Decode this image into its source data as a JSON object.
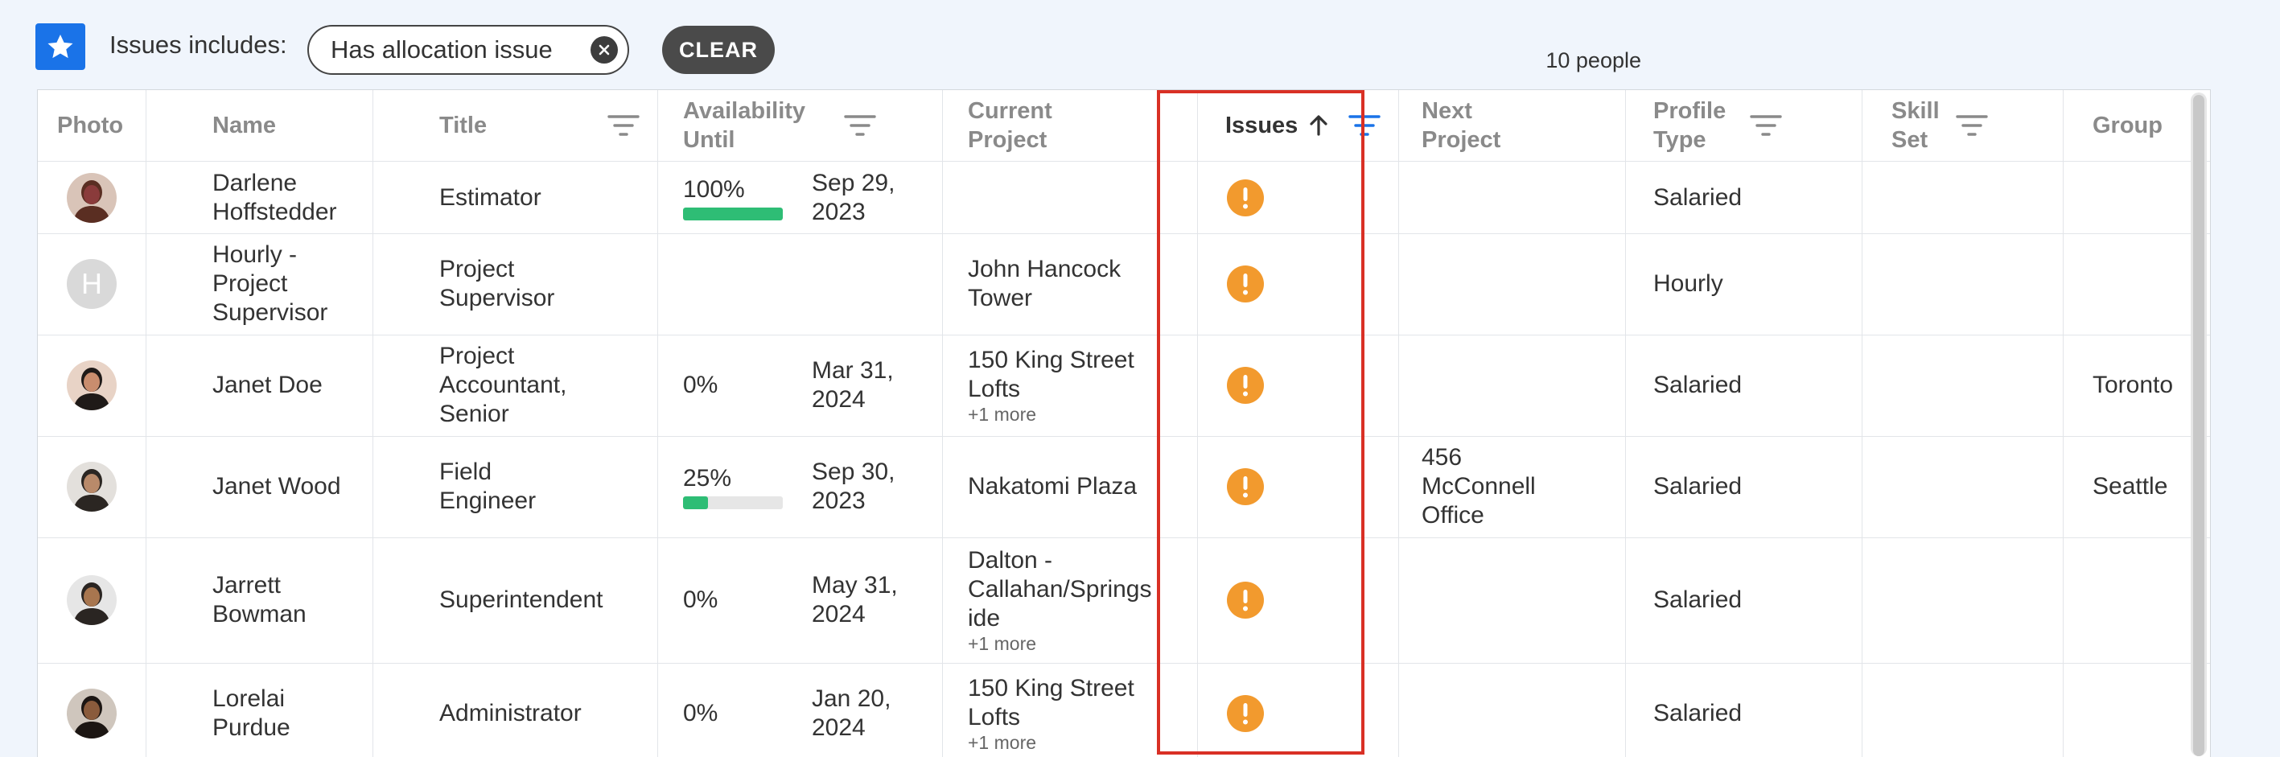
{
  "toolbar": {
    "filter_label": "Issues includes:",
    "chip_label": "Has allocation issue",
    "clear_label": "CLEAR",
    "people_count": "10 people"
  },
  "columns": {
    "photo": "Photo",
    "name": "Name",
    "title": "Title",
    "availability": "Availability Until",
    "current_project": "Current Project",
    "issues": "Issues",
    "next_project": "Next Project",
    "profile_type": "Profile Type",
    "skill_set": "Skill Set",
    "group": "Group"
  },
  "colors": {
    "accent": "#1a73e8",
    "issue": "#f29a2e",
    "highlight": "#d93025",
    "progress": "#2ebd75"
  },
  "rows": [
    {
      "name": "Darlene Hoffstedder",
      "title": "Estimator",
      "availability_pct": "100%",
      "availability_fill": 1.0,
      "availability_date": "Sep 29, 2023",
      "current_project": "",
      "current_more": "",
      "next_project": "",
      "profile_type": "Salaried",
      "skill_set": "",
      "group": "",
      "avatar": "photo"
    },
    {
      "name": "Hourly - Project Supervisor",
      "title": "Project Supervisor",
      "availability_pct": "",
      "availability_fill": null,
      "availability_date": "",
      "current_project": "John Hancock Tower",
      "current_more": "",
      "next_project": "",
      "profile_type": "Hourly",
      "skill_set": "",
      "group": "",
      "avatar": "initial",
      "avatar_initial": "H"
    },
    {
      "name": "Janet Doe",
      "title": "Project Accountant, Senior",
      "availability_pct": "0%",
      "availability_fill": null,
      "availability_date": "Mar 31, 2024",
      "current_project": "150 King Street Lofts",
      "current_more": "+1 more",
      "next_project": "",
      "profile_type": "Salaried",
      "skill_set": "",
      "group": "Toronto",
      "avatar": "photo"
    },
    {
      "name": "Janet Wood",
      "title": "Field Engineer",
      "availability_pct": "25%",
      "availability_fill": 0.25,
      "availability_date": "Sep 30, 2023",
      "current_project": "Nakatomi Plaza",
      "current_more": "",
      "next_project": "456 McConnell Office",
      "profile_type": "Salaried",
      "skill_set": "",
      "group": "Seattle",
      "avatar": "photo"
    },
    {
      "name": "Jarrett Bowman",
      "title": "Superintendent",
      "availability_pct": "0%",
      "availability_fill": null,
      "availability_date": "May 31, 2024",
      "current_project": "Dalton - Callahan/Springs ide",
      "current_more": "+1 more",
      "next_project": "",
      "profile_type": "Salaried",
      "skill_set": "",
      "group": "",
      "avatar": "photo"
    },
    {
      "name": "Lorelai Purdue",
      "title": "Administrator",
      "availability_pct": "0%",
      "availability_fill": null,
      "availability_date": "Jan 20, 2024",
      "current_project": "150 King Street Lofts",
      "current_more": "+1 more",
      "next_project": "",
      "profile_type": "Salaried",
      "skill_set": "",
      "group": "",
      "avatar": "photo"
    }
  ]
}
